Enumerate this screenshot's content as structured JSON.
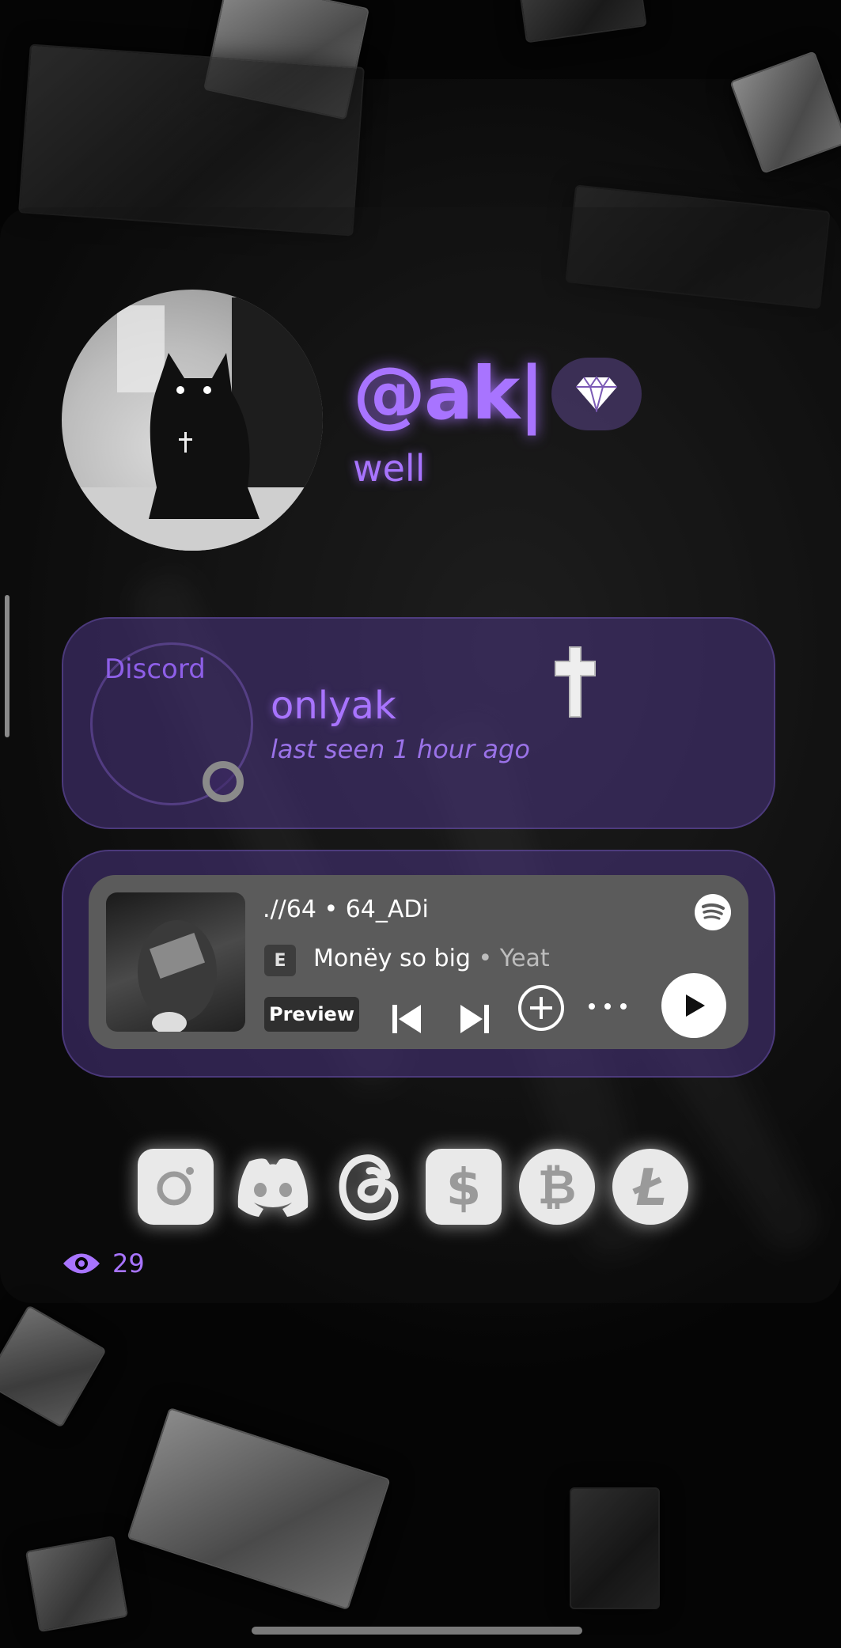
{
  "profile": {
    "username": "@ak|",
    "subtitle": "well",
    "badge_icon": "diamond-icon",
    "accent_color": "#a874ff"
  },
  "discord": {
    "alt_text": "Discord",
    "display_name": "onlyak",
    "last_seen": "last seen 1 hour ago",
    "status_color": "#8a8a8a"
  },
  "spotify": {
    "title": ".//64 • 64_ADi",
    "explicit_label": "E",
    "song": "Monëy so big",
    "separator": " • ",
    "artist": "Yeat",
    "preview_label": "Preview",
    "brand_color": "#1db954"
  },
  "socials": [
    {
      "name": "instagram-icon"
    },
    {
      "name": "discord-icon"
    },
    {
      "name": "threads-icon"
    },
    {
      "name": "cashapp-icon"
    },
    {
      "name": "bitcoin-icon"
    },
    {
      "name": "litecoin-icon"
    }
  ],
  "views": {
    "count": "29",
    "icon": "eye-icon"
  }
}
